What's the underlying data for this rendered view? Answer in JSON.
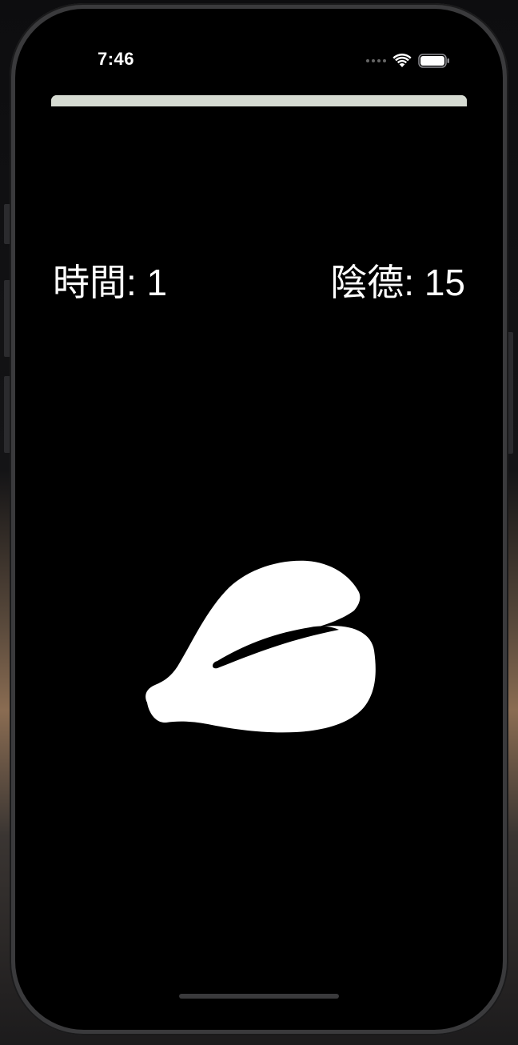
{
  "status_bar": {
    "time": "7:46",
    "icons": [
      "cellular-signal-icon",
      "wifi-icon",
      "battery-icon"
    ]
  },
  "progress": {
    "fraction": 1.0,
    "color": "#d6dbd2"
  },
  "labels": {
    "time": "時間: 1",
    "merit": "陰德: 15"
  },
  "main": {
    "icon": "wooden-fish-icon",
    "background_color": "#000000",
    "foreground_color": "#ffffff"
  }
}
